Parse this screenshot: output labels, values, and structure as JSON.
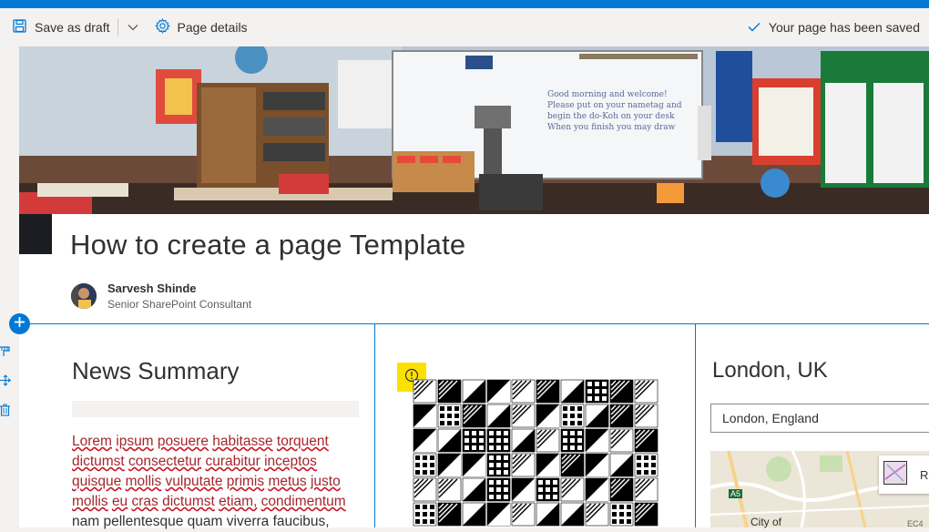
{
  "commandbar": {
    "save_draft_label": "Save as draft",
    "page_details_label": "Page details",
    "saved_status": "Your page has been saved"
  },
  "page": {
    "title": "How to create a page Template",
    "author_name": "Sarvesh Shinde",
    "author_role": "Senior SharePoint Consultant"
  },
  "webparts": {
    "news": {
      "title": "News Summary",
      "body_words": [
        "Lorem",
        "ipsum",
        "posuere",
        "habitasse",
        "torquent",
        "dictumst",
        "consectetur",
        "curabitur",
        "inceptos",
        "quisque",
        "mollis",
        "vulputate",
        "primis",
        "metus",
        "justo",
        "mollis",
        "eu",
        "cras",
        "dictumst",
        "etiam,",
        "condimentum"
      ],
      "body_tail": "nam pellentesque quam viverra faucibus,"
    },
    "weather": {
      "title": "London, UK",
      "location_value": "London, England",
      "map_chip_label": "Ro",
      "map_city_label": "City of",
      "map_road_label": "A5",
      "map_ec_label": "EC4"
    }
  },
  "colors": {
    "accent": "#0078d4",
    "warning": "#fce100",
    "spell_error": "#c50f1f"
  },
  "icons": {
    "save": "save-icon",
    "chevron": "chevron-down-icon",
    "settings": "gear-icon",
    "saved": "checkmark-icon",
    "add": "add-icon",
    "warning": "warning-icon"
  }
}
